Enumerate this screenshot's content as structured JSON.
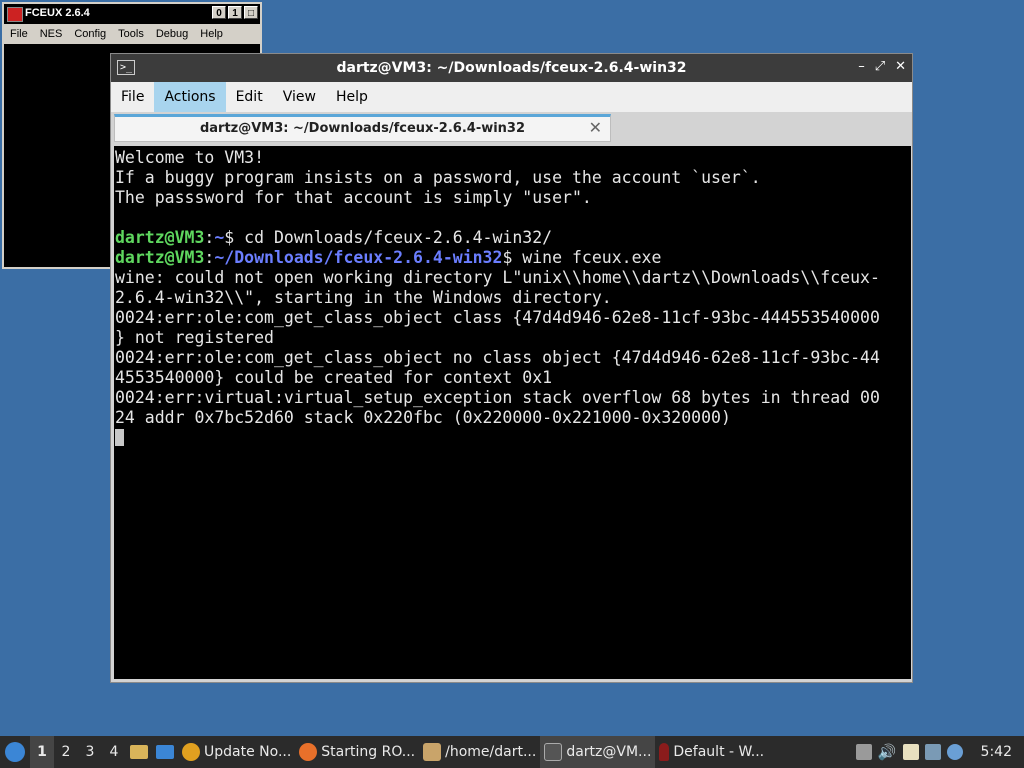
{
  "fceux": {
    "title": "FCEUX 2.6.4",
    "buttons": [
      "0",
      "1",
      "r"
    ],
    "menu": [
      "File",
      "NES",
      "Config",
      "Tools",
      "Debug",
      "Help"
    ]
  },
  "terminal": {
    "title": "dartz@VM3: ~/Downloads/fceux-2.6.4-win32",
    "controls": [
      "–",
      "⤢",
      "✕"
    ],
    "menu": [
      "File",
      "Actions",
      "Edit",
      "View",
      "Help"
    ],
    "tab_title": "dartz@VM3: ~/Downloads/fceux-2.6.4-win32",
    "tab_close": "✕",
    "lines": {
      "l1": "Welcome to VM3!",
      "l2": "If a buggy program insists on a password, use the account `user`.",
      "l3": "The passsword for that account is simply \"user\".",
      "p1_user": "dartz@VM3",
      "p1_colon": ":",
      "p1_path": "~",
      "p1_cmd": "$ cd Downloads/fceux-2.6.4-win32/",
      "p2_user": "dartz@VM3",
      "p2_colon": ":",
      "p2_path": "~/Downloads/fceux-2.6.4-win32",
      "p2_cmd": "$ wine fceux.exe",
      "o1": "wine: could not open working directory L\"unix\\\\home\\\\dartz\\\\Downloads\\\\fceux-",
      "o2": "2.6.4-win32\\\\\", starting in the Windows directory.",
      "o3": "0024:err:ole:com_get_class_object class {47d4d946-62e8-11cf-93bc-444553540000",
      "o4": "} not registered",
      "o5": "0024:err:ole:com_get_class_object no class object {47d4d946-62e8-11cf-93bc-44",
      "o6": "4553540000} could be created for context 0x1",
      "o7": "0024:err:virtual:virtual_setup_exception stack overflow 68 bytes in thread 00",
      "o8": "24 addr 0x7bc52d60 stack 0x220fbc (0x220000-0x221000-0x320000)"
    }
  },
  "taskbar": {
    "workspaces": [
      "1",
      "2",
      "3",
      "4"
    ],
    "tasks": [
      {
        "label": "Update No...",
        "color": "#e0a020"
      },
      {
        "label": "Starting RO...",
        "color": "#e8702a"
      },
      {
        "label": "/home/dart...",
        "color": "#c9a46a"
      },
      {
        "label": "dartz@VM...",
        "color": "#555555"
      },
      {
        "label": "Default - W...",
        "color": "#8a1c1c"
      }
    ],
    "clock": "5:42"
  }
}
